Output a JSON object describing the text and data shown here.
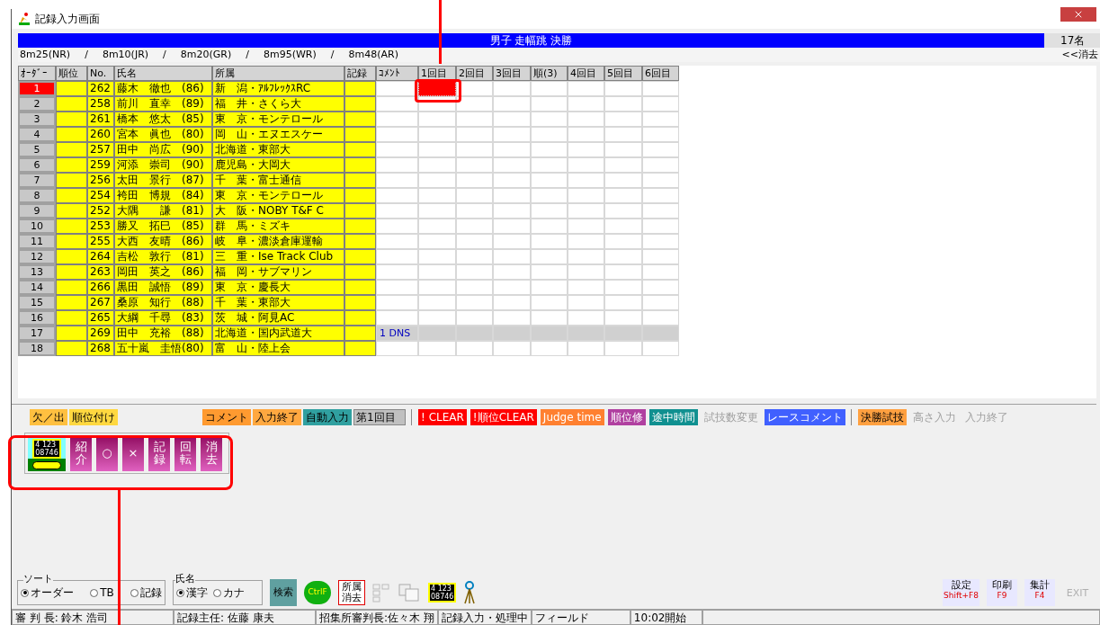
{
  "window": {
    "title": "記録入力画面"
  },
  "event": {
    "title": "男子 走幅跳 決勝",
    "count": "17名"
  },
  "records": [
    "8m25(NR)",
    "/",
    "8m10(JR)",
    "/",
    "8m20(GR)",
    "/",
    "8m95(WR)",
    "/",
    "8m48(AR)"
  ],
  "clear_link": "<<消去",
  "table": {
    "columns": [
      "ｵｰﾀﾞｰ",
      "順位",
      "No.",
      "氏名",
      "所属",
      "記録",
      "ｺﾒﾝﾄ",
      "1回目",
      "2回目",
      "3回目",
      "順(3)",
      "4回目",
      "5回目",
      "6回目"
    ],
    "rows": [
      {
        "order": "1",
        "no": "262",
        "name": "藤木　徹也　(86)",
        "affiliation": "新　潟・ｱﾙﾌﾚｯｸｽRC",
        "selected": true,
        "kind": "normal"
      },
      {
        "order": "2",
        "no": "258",
        "name": "前川　直幸　(89)",
        "affiliation": "福　井・さくら大",
        "selected": false,
        "kind": "normal"
      },
      {
        "order": "3",
        "no": "261",
        "name": "橋本　悠太　(85)",
        "affiliation": "東　京・モンテロール",
        "selected": false,
        "kind": "normal"
      },
      {
        "order": "4",
        "no": "260",
        "name": "宮本　眞也　(80)",
        "affiliation": "岡　山・エヌエスケー",
        "selected": false,
        "kind": "normal"
      },
      {
        "order": "5",
        "no": "257",
        "name": "田中　尚広　(90)",
        "affiliation": "北海道・東部大",
        "selected": false,
        "kind": "normal"
      },
      {
        "order": "6",
        "no": "259",
        "name": "河添　崇司　(90)",
        "affiliation": "鹿児島・大岡大",
        "selected": false,
        "kind": "normal"
      },
      {
        "order": "7",
        "no": "256",
        "name": "太田　景行　(87)",
        "affiliation": "千　葉・富士通信",
        "selected": false,
        "kind": "normal"
      },
      {
        "order": "8",
        "no": "254",
        "name": "袴田　博規　(84)",
        "affiliation": "東　京・モンテロール",
        "selected": false,
        "kind": "normal"
      },
      {
        "order": "9",
        "no": "252",
        "name": "大隅　　謙　(81)",
        "affiliation": "大　阪・NOBY T&F C",
        "selected": false,
        "kind": "normal"
      },
      {
        "order": "10",
        "no": "253",
        "name": "勝又　拓巳　(85)",
        "affiliation": "群　馬・ミズキ",
        "selected": false,
        "kind": "normal"
      },
      {
        "order": "11",
        "no": "255",
        "name": "大西　友晴　(86)",
        "affiliation": "岐　阜・濃淡倉庫運輸",
        "selected": false,
        "kind": "normal"
      },
      {
        "order": "12",
        "no": "264",
        "name": "吉松　敦行　(81)",
        "affiliation": "三　重・Ise Track Club",
        "selected": false,
        "kind": "normal"
      },
      {
        "order": "13",
        "no": "263",
        "name": "岡田　英之　(86)",
        "affiliation": "福　岡・サブマリン",
        "selected": false,
        "kind": "normal"
      },
      {
        "order": "14",
        "no": "266",
        "name": "黒田　誠悟　(89)",
        "affiliation": "東　京・慶長大",
        "selected": false,
        "kind": "normal"
      },
      {
        "order": "15",
        "no": "267",
        "name": "桑原　知行　(88)",
        "affiliation": "千　葉・東部大",
        "selected": false,
        "kind": "normal"
      },
      {
        "order": "16",
        "no": "265",
        "name": "大綱　千尋　(83)",
        "affiliation": "茨　城・阿見AC",
        "selected": false,
        "kind": "normal"
      },
      {
        "order": "17",
        "no": "269",
        "name": "田中　充裕　(88)",
        "affiliation": "北海道・国内武道大",
        "selected": false,
        "kind": "absent",
        "comment": "1 DNS"
      },
      {
        "order": "18",
        "no": "268",
        "name": "五十嵐　圭悟(80)",
        "affiliation": "富　山・陸上会",
        "selected": false,
        "kind": "normal"
      }
    ]
  },
  "toolbar_left": [
    {
      "label": "欠／出",
      "color": "#ffc040"
    },
    {
      "label": "順位付け",
      "color": "#ffd840"
    }
  ],
  "toolbar_mid": [
    {
      "label": "コメント",
      "color": "#ff9a30"
    },
    {
      "label": "入力終了",
      "color": "#ffa840"
    },
    {
      "label": "自動入力",
      "color": "#30a0a0"
    }
  ],
  "round_field": {
    "value": "第1回目"
  },
  "toolbar_right": [
    {
      "label": "! CLEAR",
      "color": "#ff0000",
      "disabled": false
    },
    {
      "label": "!順位CLEAR",
      "color": "#ff0000",
      "disabled": false
    },
    {
      "label": "Judge time",
      "color": "#ff8030",
      "disabled": false
    },
    {
      "label": "順位修",
      "color": "#b040a0",
      "disabled": false
    },
    {
      "label": "途中時間",
      "color": "#109090",
      "disabled": false
    },
    {
      "label": "試技数変更",
      "disabled": true
    },
    {
      "label": "レースコメント",
      "color": "#4060ff",
      "disabled": false
    }
  ],
  "toolbar_end": [
    {
      "label": "決勝試技",
      "color": "#ffa040",
      "disabled": false
    },
    {
      "label": "高さ入力",
      "disabled": true
    },
    {
      "label": "入力終了",
      "disabled": true
    }
  ],
  "scoreboard": [
    "4  123",
    "08746"
  ],
  "mini_scoreboard": [
    "4  123",
    "08746"
  ],
  "action_buttons": [
    "紹介",
    "○",
    "×",
    "記録",
    "回転",
    "消去"
  ],
  "sort": {
    "title": "ソート",
    "options": [
      {
        "label": "オーダー",
        "selected": true
      },
      {
        "label": "TB",
        "selected": false
      },
      {
        "label": "記録",
        "selected": false
      }
    ]
  },
  "name_mode": {
    "title": "氏名",
    "options": [
      {
        "label": "漢字",
        "selected": true
      },
      {
        "label": "カナ",
        "selected": false
      }
    ]
  },
  "search_button": "検索",
  "ctrlf_button": "CtrlF",
  "clear_affiliation_button": "所属消去",
  "right_tools": [
    {
      "label": "設定",
      "sub": "Shift+F8",
      "disabled": false
    },
    {
      "label": "印刷",
      "sub": "F9",
      "disabled": false
    },
    {
      "label": "集計",
      "sub": "F4",
      "disabled": false
    },
    {
      "label": "EXIT",
      "disabled": true
    }
  ],
  "status_bar": [
    "審 判 長: 鈴木 浩司",
    "記録主任: 佐藤 康夫",
    "招集所審判長:佐々木 翔",
    "記録入力・処理中",
    "フィールド",
    "10:02開始"
  ]
}
